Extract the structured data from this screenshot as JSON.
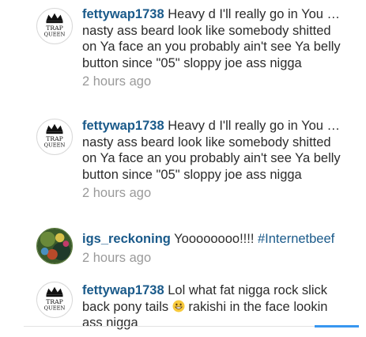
{
  "comments": [
    {
      "username": "fettywap1738",
      "text": "Heavy d I'll really go in You … nasty ass beard look like somebody shitted on Ya face an you probably ain't see Ya belly button since \"05\" sloppy joe ass nigga",
      "time": "2 hours ago",
      "avatar": "trap-queen-logo",
      "avatar_text": [
        "TRAP",
        "QUEEN"
      ]
    },
    {
      "username": "fettywap1738",
      "text": "Heavy d I'll really go in You … nasty ass beard look like somebody shitted on Ya face an you probably ain't see Ya belly button since \"05\" sloppy joe ass nigga",
      "time": "2 hours ago",
      "avatar": "trap-queen-logo",
      "avatar_text": [
        "TRAP",
        "QUEEN"
      ]
    },
    {
      "username": "igs_reckoning",
      "text": "Yoooooooo!!!! ",
      "hashtag": "#Internetbeef",
      "time": "2 hours ago",
      "avatar": "colorful-photo"
    },
    {
      "username": "fettywap1738",
      "text_before_emoji": "Lol what fat nigga rock slick back pony tails",
      "emoji": "grinning-face",
      "text_after_emoji": " rakishi in the face lookin ass nigga",
      "avatar": "trap-queen-logo",
      "avatar_text": [
        "TRAP",
        "QUEEN"
      ]
    }
  ],
  "colors": {
    "username": "#1a5a8a",
    "text": "#2b2b2b",
    "timestamp": "#9a9a9a",
    "accent": "#3897f0"
  }
}
